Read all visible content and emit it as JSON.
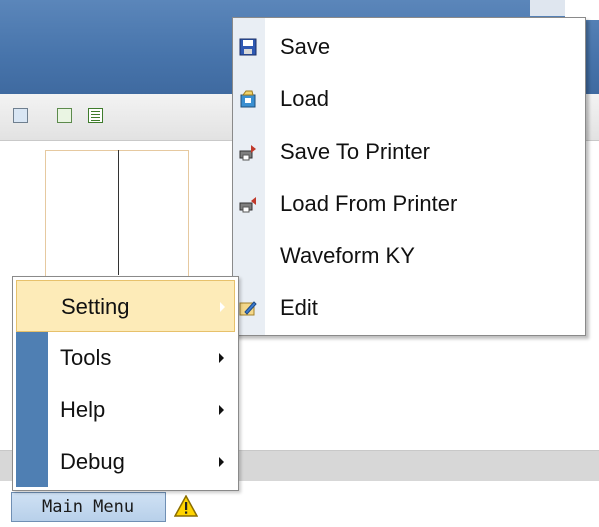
{
  "submenu": {
    "items": [
      {
        "label": "Save",
        "icon": "save-icon"
      },
      {
        "label": "Load",
        "icon": "load-icon"
      },
      {
        "label": "Save To Printer",
        "icon": "save-to-printer-icon"
      },
      {
        "label": "Load From Printer",
        "icon": "load-from-printer-icon"
      },
      {
        "label": "Waveform KY",
        "icon": ""
      },
      {
        "label": "Edit",
        "icon": "edit-icon"
      }
    ]
  },
  "main_menu": {
    "items": [
      {
        "label": "Setting",
        "active": true
      },
      {
        "label": "Tools"
      },
      {
        "label": "Help"
      },
      {
        "label": "Debug"
      }
    ]
  },
  "taskbar": {
    "start_label": "Main Menu",
    "icons": [
      "main-menu-icon",
      "warning-icon"
    ]
  },
  "colors": {
    "title_band": "#4774ab",
    "menu_highlight": "#fdebb8",
    "menu_strip": "#4f7fb3"
  }
}
